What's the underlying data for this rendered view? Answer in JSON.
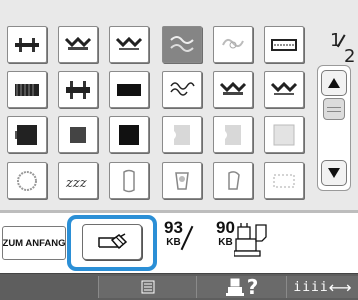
{
  "pattern_grid": {
    "rows": [
      [
        {
          "name": "stitch-pattern-1-icon",
          "selected": false
        },
        {
          "name": "stitch-pattern-2-icon",
          "selected": false
        },
        {
          "name": "stitch-pattern-3-icon",
          "selected": false
        },
        {
          "name": "stitch-pattern-4-icon",
          "selected": true
        },
        {
          "name": "stitch-pattern-5-icon",
          "selected": false
        },
        {
          "name": "stitch-pattern-6-icon",
          "selected": false
        }
      ],
      [
        {
          "name": "stitch-pattern-7-icon",
          "selected": false
        },
        {
          "name": "stitch-pattern-8-icon",
          "selected": false
        },
        {
          "name": "stitch-pattern-9-icon",
          "selected": false
        },
        {
          "name": "stitch-pattern-10-icon",
          "selected": false
        },
        {
          "name": "stitch-pattern-11-icon",
          "selected": false
        },
        {
          "name": "stitch-pattern-12-icon",
          "selected": false
        }
      ],
      [
        {
          "name": "stitch-pattern-13-icon",
          "selected": false
        },
        {
          "name": "stitch-pattern-14-icon",
          "selected": false
        },
        {
          "name": "stitch-pattern-15-icon",
          "selected": false
        },
        {
          "name": "stitch-pattern-16-icon",
          "selected": false
        },
        {
          "name": "stitch-pattern-17-icon",
          "selected": false
        },
        {
          "name": "stitch-pattern-18-icon",
          "selected": false
        }
      ],
      [
        {
          "name": "stitch-pattern-19-icon",
          "selected": false
        },
        {
          "name": "stitch-pattern-20-icon",
          "selected": false
        },
        {
          "name": "stitch-pattern-21-icon",
          "selected": false
        },
        {
          "name": "stitch-pattern-22-icon",
          "selected": false
        },
        {
          "name": "stitch-pattern-23-icon",
          "selected": false
        },
        {
          "name": "stitch-pattern-24-icon",
          "selected": false
        }
      ]
    ]
  },
  "pagination": {
    "current": "1",
    "total": "2"
  },
  "scroll": {
    "up_icon": "triangle-up-icon",
    "down_icon": "triangle-down-icon"
  },
  "bottom": {
    "home_label": "ZUM ANFANG",
    "delete_icon": "eraser-icon",
    "pc_memory": {
      "value": "93",
      "unit": "KB"
    },
    "machine_memory": {
      "value": "90",
      "unit": "KB"
    }
  },
  "toolbar": {
    "question": "?",
    "density_bars": "iiii",
    "density_arrow": "⟷"
  },
  "colors": {
    "highlight": "#2b8fd6",
    "panel": "#e9e9e9",
    "toolbar": "#5e5e5e",
    "selected_cell": "#858585"
  }
}
